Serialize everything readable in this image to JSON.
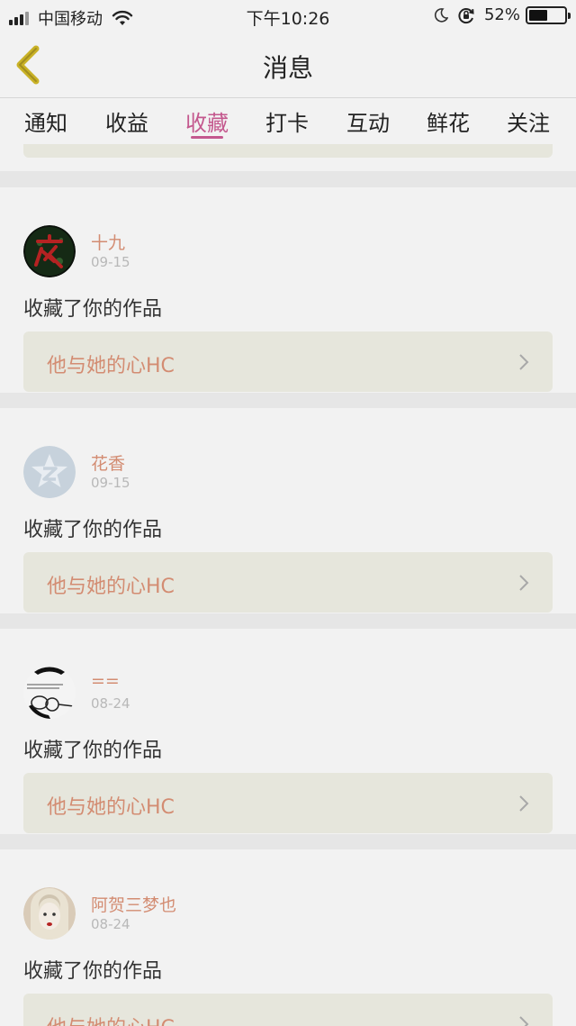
{
  "status_bar": {
    "carrier": "中国移动",
    "time": "下午10:26",
    "battery_percent": "52%",
    "battery_level": 0.52,
    "icons": [
      "signal-icon",
      "wifi-icon",
      "moon-icon",
      "rotation-lock-icon",
      "battery-icon"
    ]
  },
  "header": {
    "title": "消息",
    "back_icon": "chevron-left-icon",
    "back_color": "#c9b227"
  },
  "tabs": {
    "items": [
      "通知",
      "收益",
      "收藏",
      "打卡",
      "互动",
      "鲜花",
      "关注"
    ],
    "active_index": 2,
    "active_color": "#c4588e"
  },
  "colors": {
    "username": "#d38c72",
    "work_title": "#d38c72",
    "date": "#b8b8b8"
  },
  "feed": [
    {
      "user": "十九",
      "date": "09-15",
      "action": "收藏了你的作品",
      "work": "他与她的心HC"
    },
    {
      "user": "花香",
      "date": "09-15",
      "action": "收藏了你的作品",
      "work": "他与她的心HC"
    },
    {
      "user": "==",
      "date": "08-24",
      "action": "收藏了你的作品",
      "work": "他与她的心HC"
    },
    {
      "user": "阿贺三梦也",
      "date": "08-24",
      "action": "收藏了你的作品",
      "work": "他与她的心HC"
    }
  ]
}
